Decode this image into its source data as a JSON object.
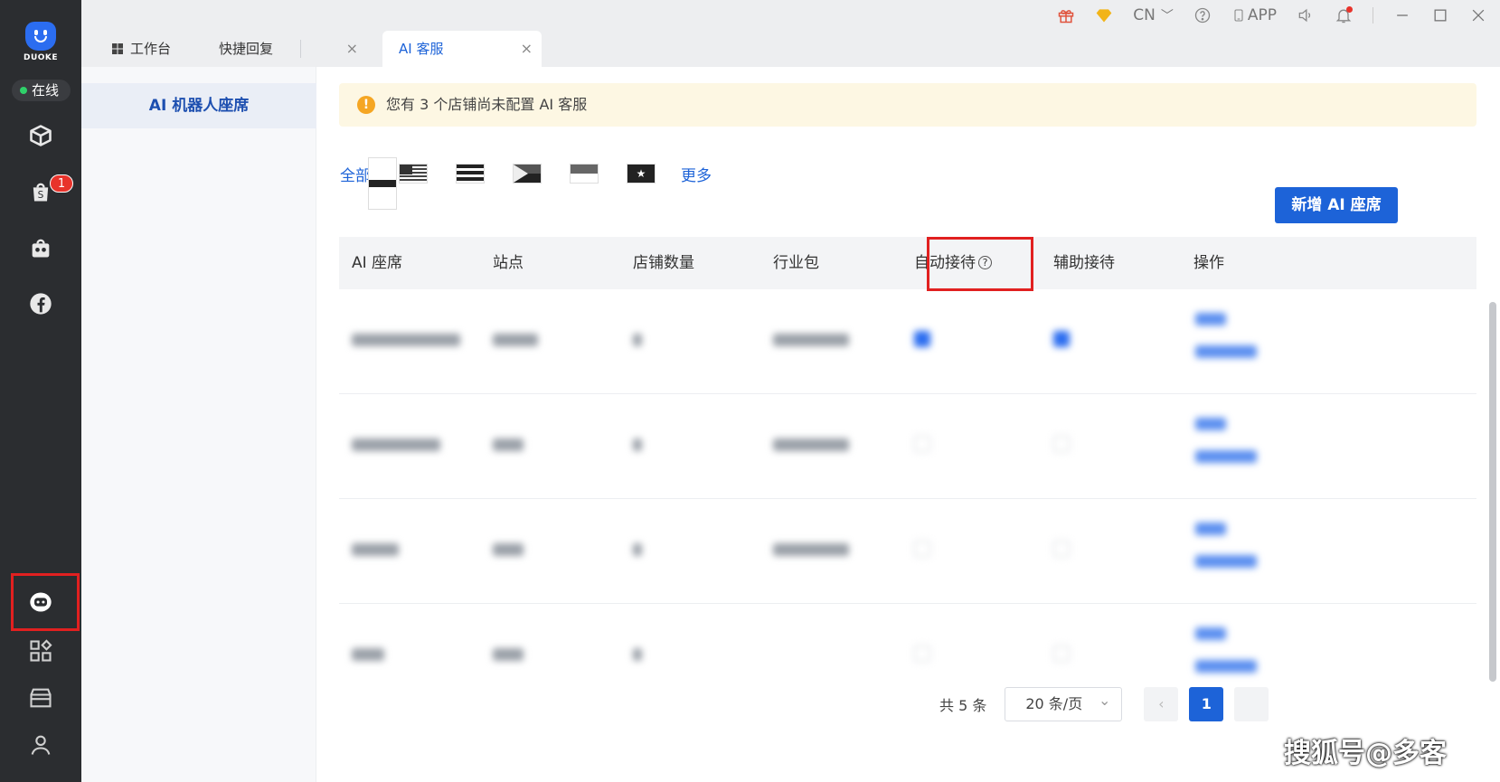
{
  "sidebar": {
    "brand": "DUOKE",
    "status": "在线",
    "badge": "1",
    "icons": [
      "box-icon",
      "shopee-bag-icon",
      "bot-bag-icon",
      "facebook-icon",
      "ai-robot-icon",
      "apps-grid-icon",
      "store-icon",
      "user-icon"
    ]
  },
  "tabs": [
    {
      "label": "工作台",
      "closable": false
    },
    {
      "label": "快捷回复",
      "closable": true
    },
    {
      "label": "AI 客服",
      "closable": true,
      "active": true
    }
  ],
  "topbar": {
    "lang": "CN",
    "app": "APP"
  },
  "subnav": {
    "item": "AI 机器人座席"
  },
  "notice": {
    "text": "您有 3 个店铺尚未配置 AI 客服"
  },
  "filters": {
    "all": "全部",
    "more": "更多",
    "flags": [
      "malaysia-flag-icon",
      "thailand-flag-icon",
      "indonesia-flag-icon",
      "philippines-flag-icon",
      "singapore-flag-icon",
      "vietnam-flag-icon"
    ]
  },
  "add_button": "新增 AI 座席",
  "table": {
    "headers": [
      "AI 座席",
      "站点",
      "店铺数量",
      "行业包",
      "自动接待",
      "辅助接待",
      "操作"
    ],
    "rows": [
      {
        "auto": true,
        "assist": true
      },
      {
        "auto": false,
        "assist": false
      },
      {
        "auto": false,
        "assist": false
      },
      {
        "auto": false,
        "assist": false
      }
    ]
  },
  "pager": {
    "total": "共 5 条",
    "size": "20 条/页",
    "current": "1"
  },
  "watermark": "搜狐号@多客",
  "colors": {
    "accent": "#1d63d8",
    "sidebar": "#2b2d30",
    "highlight": "#e12020"
  }
}
